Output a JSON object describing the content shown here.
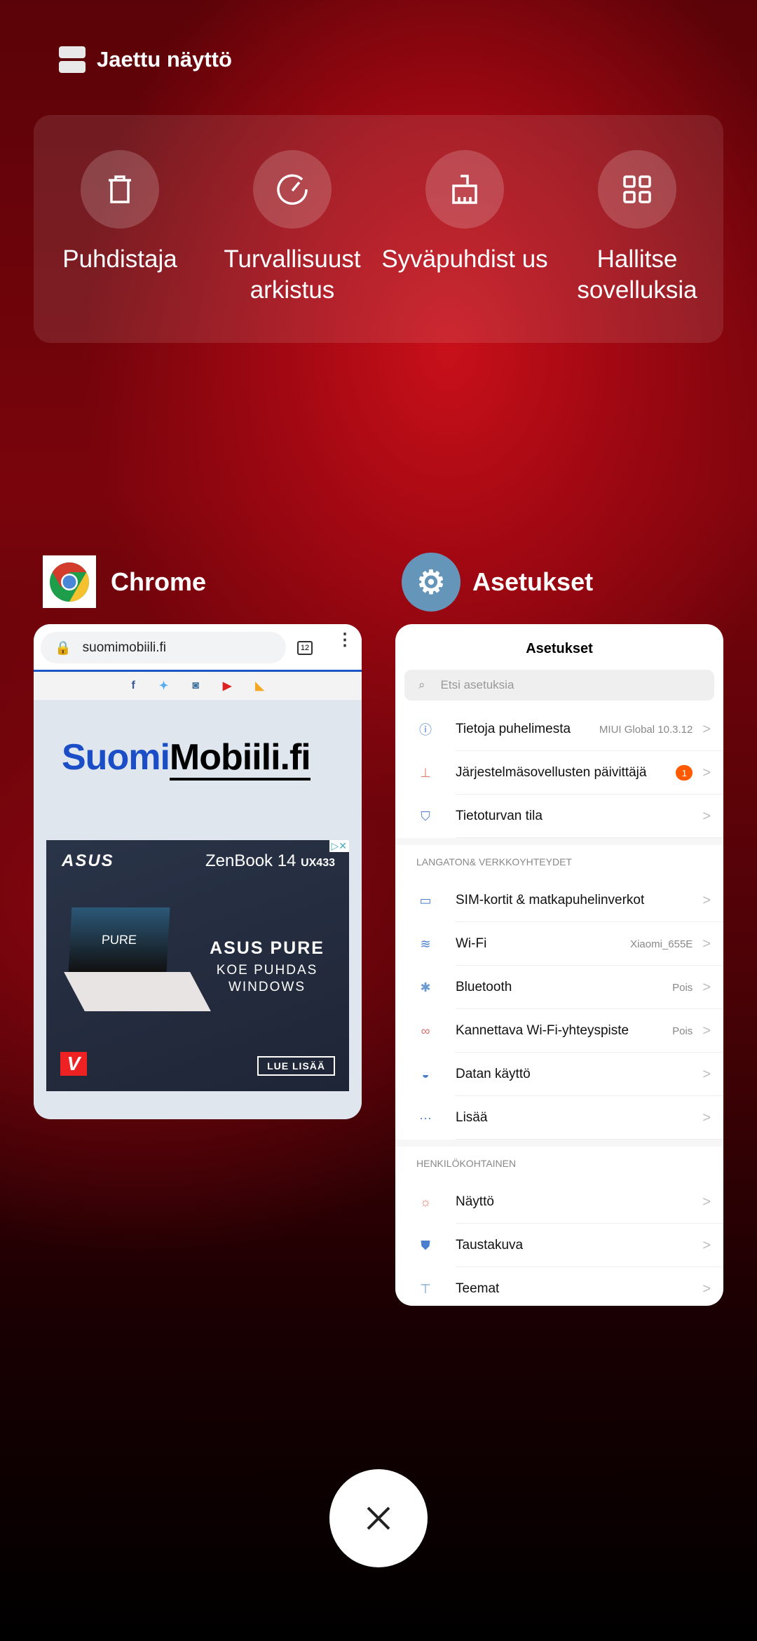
{
  "split_screen": {
    "label": "Jaettu näyttö",
    "icon": "split-screen-icon"
  },
  "tools": [
    {
      "label": "Puhdistaja",
      "icon": "trash-icon"
    },
    {
      "label": "Turvallisuust arkistus",
      "icon": "gauge-icon"
    },
    {
      "label": "Syväpuhdist us",
      "icon": "brush-icon"
    },
    {
      "label": "Hallitse sovelluksia",
      "icon": "apps-grid-icon"
    }
  ],
  "apps": {
    "chrome": {
      "name": "Chrome",
      "url": "suomimobiili.fi",
      "tab_count": "12",
      "logo_blue": "Suomi",
      "logo_black": "Mobiili.fi",
      "ad": {
        "brand": "ASUS",
        "model": "ZenBook 14",
        "model_code": "UX433",
        "screen": "PURE",
        "headline": "ASUS PURE",
        "line1": "KOE PUHDAS",
        "line2": "WINDOWS",
        "cta": "LUE LISÄÄ",
        "badge": "V"
      }
    },
    "settings": {
      "name": "Asetukset",
      "title": "Asetukset",
      "search_placeholder": "Etsi asetuksia",
      "group1": [
        {
          "label": "Tietoja puhelimesta",
          "value": "MIUI Global 10.3.12",
          "icon": "info-icon"
        },
        {
          "label": "Järjestelmäsovellusten päivittäjä",
          "badge": "1",
          "icon": "update-icon"
        },
        {
          "label": "Tietoturvan tila",
          "icon": "shield-icon"
        }
      ],
      "section2": "LANGATON& VERKKOYHTEYDET",
      "group2": [
        {
          "label": "SIM-kortit & matkapuhelinverkot",
          "icon": "sim-icon"
        },
        {
          "label": "Wi-Fi",
          "value": "Xiaomi_655E",
          "icon": "wifi-icon"
        },
        {
          "label": "Bluetooth",
          "value": "Pois",
          "icon": "bluetooth-icon"
        },
        {
          "label": "Kannettava Wi-Fi-yhteyspiste",
          "value": "Pois",
          "icon": "hotspot-icon"
        },
        {
          "label": "Datan käyttö",
          "icon": "data-usage-icon"
        },
        {
          "label": "Lisää",
          "icon": "more-icon"
        }
      ],
      "section3": "HENKILÖKOHTAINEN",
      "group3": [
        {
          "label": "Näyttö",
          "icon": "display-icon"
        },
        {
          "label": "Taustakuva",
          "icon": "wallpaper-icon"
        },
        {
          "label": "Teemat",
          "icon": "themes-icon"
        }
      ]
    }
  },
  "close_icon": "close-icon"
}
